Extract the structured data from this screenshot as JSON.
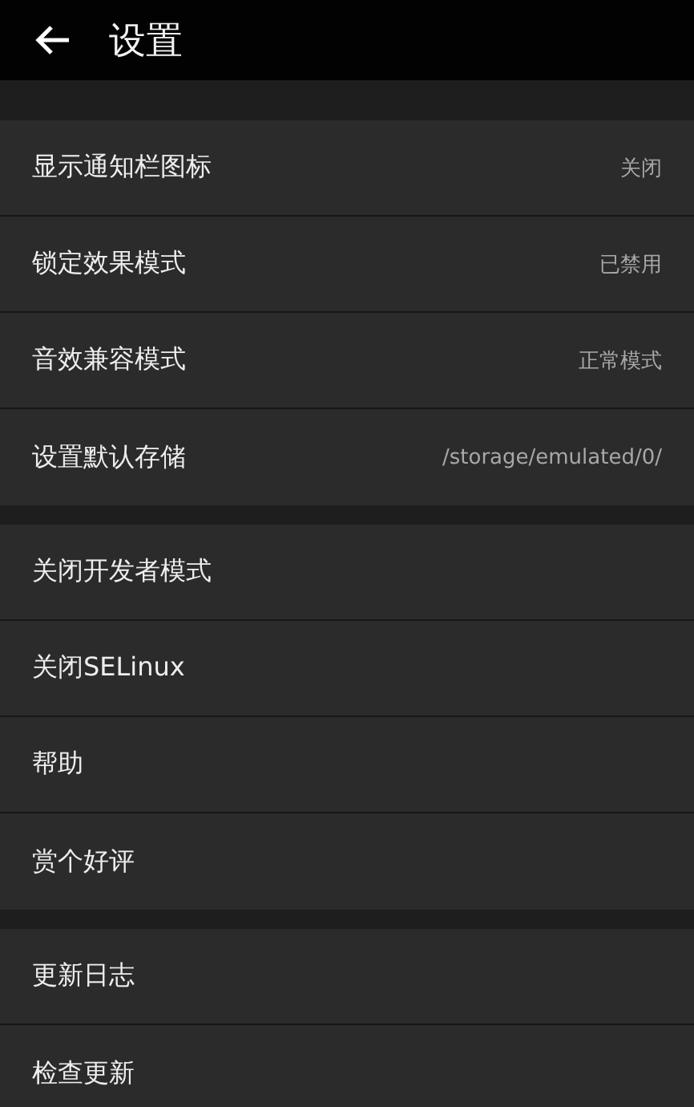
{
  "header": {
    "title": "设置"
  },
  "sections": [
    {
      "items": [
        {
          "label": "显示通知栏图标",
          "value": "关闭"
        },
        {
          "label": "锁定效果模式",
          "value": "已禁用"
        },
        {
          "label": "音效兼容模式",
          "value": "正常模式"
        },
        {
          "label": "设置默认存储",
          "value": "/storage/emulated/0/"
        }
      ]
    },
    {
      "items": [
        {
          "label": "关闭开发者模式"
        },
        {
          "label": "关闭SELinux"
        },
        {
          "label": "帮助"
        },
        {
          "label": "赏个好评"
        }
      ]
    },
    {
      "items": [
        {
          "label": "更新日志"
        },
        {
          "label": "检查更新"
        }
      ]
    }
  ]
}
